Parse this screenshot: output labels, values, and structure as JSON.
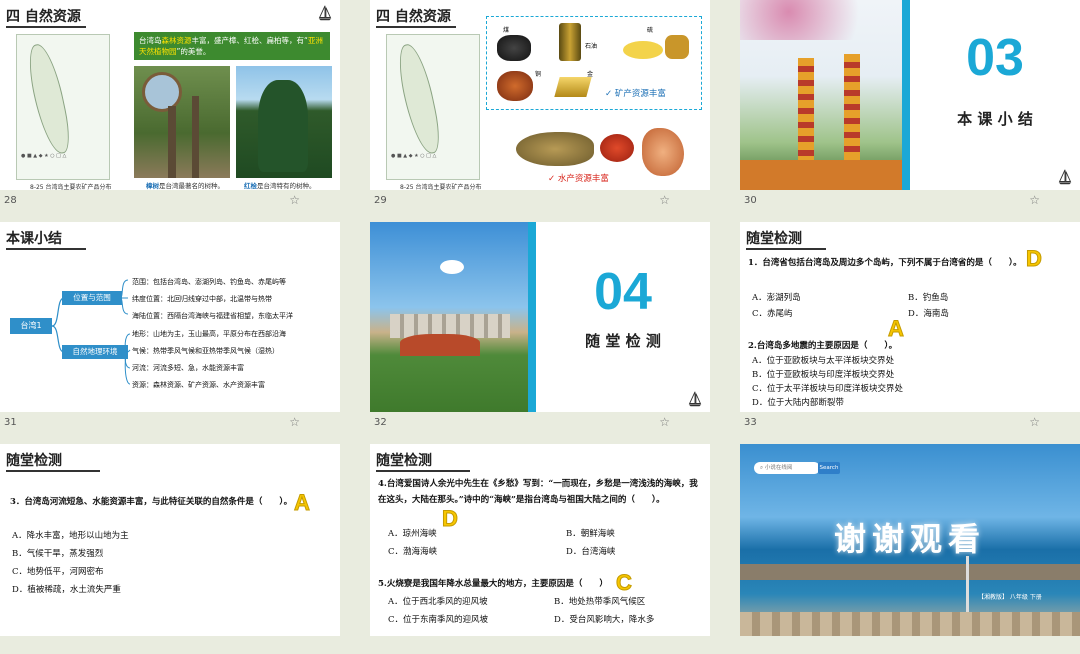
{
  "slides": [
    {
      "number": "28",
      "title": "四 自然资源",
      "highlight_pre": "台湾岛",
      "highlight_em1": "森林资源",
      "highlight_mid": "丰富，盛产樟、红桧、扁柏等，有“",
      "highlight_em2": "亚洲天然植物园",
      "highlight_post": "”的美誉。",
      "map_caption": "8-25 台湾岛主要农矿产品分布",
      "photo1_caption_em": "樟树",
      "photo1_caption": "是台湾最著名的树种。",
      "photo2_caption_em": "红桧",
      "photo2_caption": "是台湾特有的树种。"
    },
    {
      "number": "29",
      "title": "四 自然资源",
      "map_caption": "8-25 台湾岛主要农矿产品分布",
      "labels": [
        "煤",
        "石油",
        "硫",
        "铜",
        "金"
      ],
      "mineral_text": "✓ 矿产资源丰富",
      "aquatic_text": "✓ 水产资源丰富"
    },
    {
      "number": "30",
      "big_number": "03",
      "subtitle": "本 课 小 结"
    },
    {
      "number": "31",
      "title": "本课小结",
      "root": "台湾1",
      "branch1": "位置与范围",
      "branch2": "自然地理环境",
      "items1": [
        "范围：包括台湾岛、澎湖列岛、钓鱼岛、赤尾屿等",
        "纬度位置：北回归线穿过中部，北温带与热带",
        "海陆位置：西隔台湾海峡与福建省相望，东临太平洋"
      ],
      "items2": [
        "地形：山地为主，玉山最高，平原分布在西部沿海",
        "气候：热带季风气候和亚热带季风气候（湿热）",
        "河流：河流多短、急，水能资源丰富",
        "资源：森林资源、矿产资源、水产资源丰富"
      ]
    },
    {
      "number": "32",
      "big_number": "04",
      "subtitle": "随 堂 检 测"
    },
    {
      "number": "33",
      "title": "随堂检测",
      "q1": "1．台湾省包括台湾岛及周边多个岛屿，下列不属于台湾省的是（　　）。",
      "q1_options": [
        "A．澎湖列岛",
        "B．钓鱼岛",
        "C．赤尾屿",
        "D．海南岛"
      ],
      "q1_answer": "D",
      "q2": "2.台湾岛多地震的主要原因是（　　）。",
      "q2_options": [
        "A．位于亚欧板块与太平洋板块交界处",
        "B．位于亚欧板块与印度洋板块交界处",
        "C．位于太平洋板块与印度洋板块交界处",
        "D．位于大陆内部断裂带"
      ],
      "q2_answer": "A"
    },
    {
      "number": "",
      "title": "随堂检测",
      "q3": "3．台湾岛河流短急、水能资源丰富，与此特征关联的自然条件是（　　）。",
      "q3_options": [
        "A．降水丰富，地形以山地为主",
        "B．气候干旱，蒸发强烈",
        "C．地势低平，河网密布",
        "D．植被稀疏，水土流失严重"
      ],
      "q3_answer": "A"
    },
    {
      "number": "",
      "title": "随堂检测",
      "q4": "4.台湾爱国诗人余光中先生在《乡愁》写到：“一而现在，乡愁是一湾浅浅的海峡，我在这头，大陆在那头。”诗中的“海峡”是指台湾岛与祖国大陆之间的（　　）。",
      "q4_options": [
        "A．琼州海峡",
        "B．朝鲜海峡",
        "C．渤海海峡",
        "D．台湾海峡"
      ],
      "q4_answer": "D",
      "q5": "5.火烧寮是我国年降水总量最大的地方，主要原因是（　　）",
      "q5_options": [
        "A．位于西北季风的迎风坡",
        "B．地处热带季风气候区",
        "C．位于东南季风的迎风坡",
        "D．受台风影响大，降水多"
      ],
      "q5_answer": "C"
    },
    {
      "number": "",
      "search_placeholder": "小说在线阅",
      "search_button": "Search",
      "thanks": "谢谢观看",
      "footer": "【湘教版】 八年级 下册"
    }
  ]
}
